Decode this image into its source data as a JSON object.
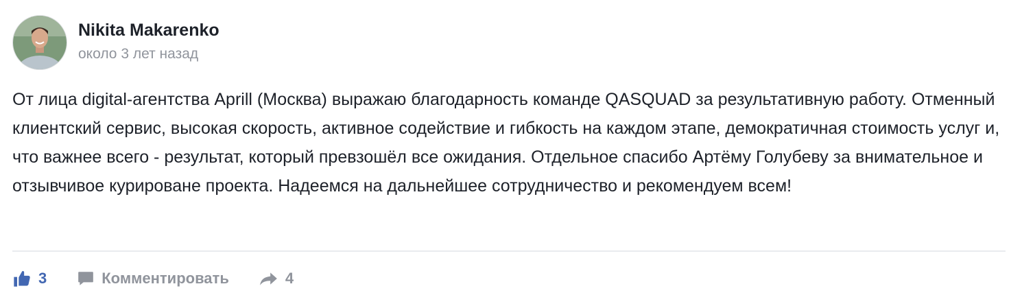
{
  "post": {
    "author": "Nikita Makarenko",
    "timestamp": "около 3 лет назад",
    "body": "От лица digital-агентства Aprill (Москва) выражаю благодарность команде QASQUAD за результативную работу. Отменный клиентский сервис, высокая скорость, активное содействие и гибкость на каждом этапе, демократичная стоимость услуг и, что важнее всего - результат, который превзошёл все ожидания. Отдельное спасибо Артёму Голубеву за внимательное и отзывчивое курироване проекта. Надеемся на дальнейшее сотрудничество и рекомендуем всем!"
  },
  "actions": {
    "like_count": "3",
    "comment_label": "Комментировать",
    "share_count": "4"
  },
  "icons": {
    "like": "thumbs-up-icon",
    "comment": "comment-bubble-icon",
    "share": "share-arrow-icon"
  },
  "colors": {
    "accent": "#4267b2",
    "muted": "#90949c",
    "text": "#1d2129",
    "divider": "#e9ebee"
  }
}
